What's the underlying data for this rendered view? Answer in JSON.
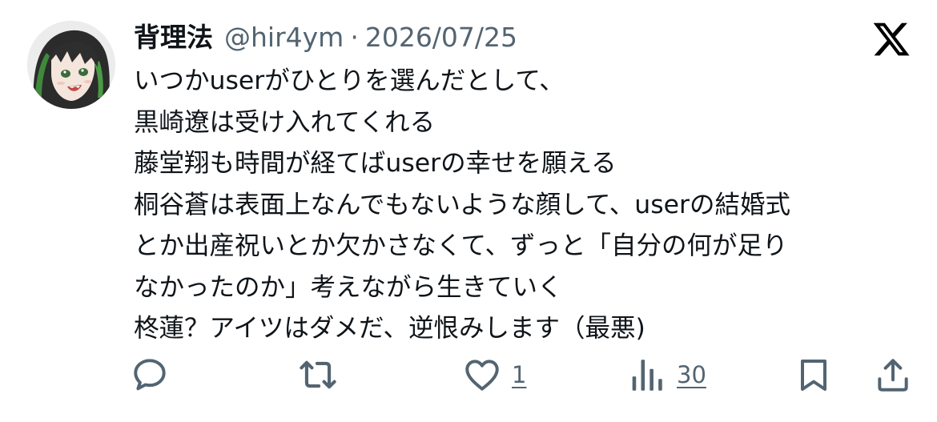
{
  "author": {
    "display_name": "背理法",
    "handle": "@hir4ym",
    "separator": "·",
    "date": "2026/07/25"
  },
  "brand_icon": "x-logo-icon",
  "body_lines": [
    "いつかuserがひとりを選んだとして、",
    "黒崎遼は受け入れてくれる",
    "藤堂翔も時間が経てばuserの幸せを願える",
    "桐谷蒼は表面上なんでもないような顔して、userの結婚式",
    "とか出産祝いとか欠かさなくて、ずっと「自分の何が足り",
    "なかったのか」考えながら生きていく",
    "柊蓮？アイツはダメだ、逆恨みします（最悪)"
  ],
  "actions": {
    "reply_icon": "speech-bubble-icon",
    "retweet_icon": "retweet-arrows-icon",
    "like_icon": "heart-icon",
    "like_count": "1",
    "views_icon": "bar-chart-icon",
    "views_count": "30",
    "bookmark_icon": "bookmark-icon",
    "share_icon": "share-upload-icon"
  },
  "colors": {
    "text_primary": "#0f1419",
    "text_secondary": "#536471",
    "background": "#ffffff"
  }
}
